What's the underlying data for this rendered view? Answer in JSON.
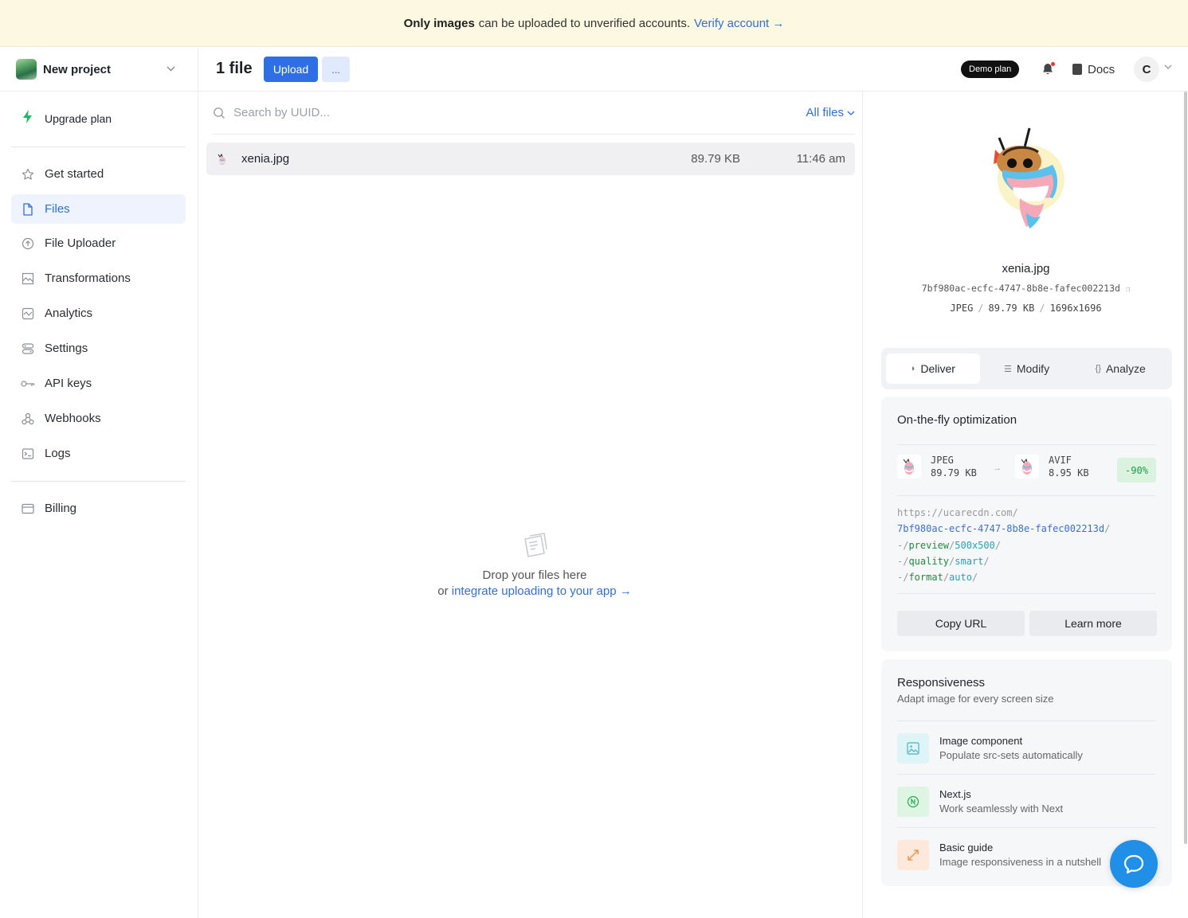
{
  "banner": {
    "bold": "Only images",
    "text": "can be uploaded to unverified accounts.",
    "link": "Verify account →"
  },
  "sidebar": {
    "project_name": "New project",
    "upgrade_label": "Upgrade plan",
    "items": [
      {
        "label": "Get started",
        "icon": "star-icon"
      },
      {
        "label": "Files",
        "icon": "file-icon",
        "active": true
      },
      {
        "label": "File Uploader",
        "icon": "upload-icon"
      },
      {
        "label": "Transformations",
        "icon": "transform-icon"
      },
      {
        "label": "Analytics",
        "icon": "analytics-icon"
      },
      {
        "label": "Settings",
        "icon": "settings-icon"
      },
      {
        "label": "API keys",
        "icon": "key-icon"
      },
      {
        "label": "Webhooks",
        "icon": "webhook-icon"
      },
      {
        "label": "Logs",
        "icon": "terminal-icon"
      }
    ],
    "billing_label": "Billing"
  },
  "header": {
    "title": "1 file",
    "upload_label": "Upload",
    "more_label": "...",
    "plan_badge": "Demo plan",
    "docs_label": "Docs",
    "avatar_initial": "C"
  },
  "search": {
    "placeholder": "Search by UUID...",
    "filter_label": "All files"
  },
  "files": [
    {
      "name": "xenia.jpg",
      "size": "89.79 KB",
      "time": "11:46 am"
    }
  ],
  "empty_state": {
    "line1": "Drop your files here",
    "line2_prefix": "or",
    "link": "integrate uploading to your app →"
  },
  "detail": {
    "name": "xenia.jpg",
    "uuid": "7bf980ac-ecfc-4747-8b8e-fafec002213d",
    "format": "JPEG",
    "size": "89.79 KB",
    "dimensions": "1696x1696",
    "tabs": [
      "Deliver",
      "Modify",
      "Analyze"
    ],
    "optimization": {
      "title": "On-the-fly optimization",
      "from_format": "JPEG",
      "from_size": "89.79 KB",
      "to_format": "AVIF",
      "to_size": "8.95 KB",
      "saving": "-90%",
      "url_base": "https://ucarecdn.com/",
      "url_uuid": "7bf980ac-ecfc-4747-8b8e-fafec002213d",
      "ops": [
        {
          "op": "preview",
          "val": "500x500"
        },
        {
          "op": "quality",
          "val": "smart"
        },
        {
          "op": "format",
          "val": "auto"
        }
      ],
      "copy_label": "Copy URL",
      "learn_label": "Learn more"
    },
    "responsiveness": {
      "title": "Responsiveness",
      "subtitle": "Adapt image for every screen size",
      "items": [
        {
          "title": "Image component",
          "sub": "Populate src-sets automatically",
          "icon": "image-icon",
          "color": "#dff4f7"
        },
        {
          "title": "Next.js",
          "sub": "Work seamlessly with Next",
          "icon": "nextjs-icon",
          "color": "#def5e3"
        },
        {
          "title": "Basic guide",
          "sub": "Image responsiveness in a nutshell",
          "icon": "resize-icon",
          "color": "#fde9dc"
        }
      ]
    }
  },
  "colors": {
    "accent": "#2f6fe6",
    "banner_bg": "#fdf8e1",
    "saving_bg": "#d9f3df",
    "chat": "#1f8fe8"
  }
}
